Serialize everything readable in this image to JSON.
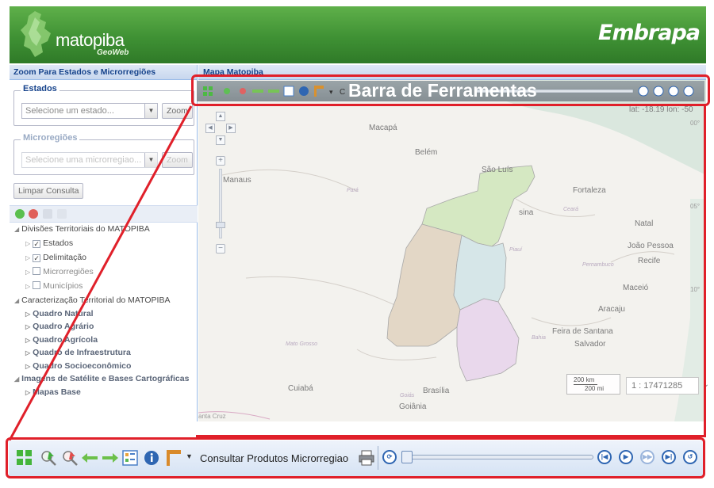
{
  "header": {
    "logo_text": "matopiba",
    "logo_sub": "GeoWeb",
    "brand": "Embrapa"
  },
  "left_panel": {
    "title": "Zoom Para Estados e Microrregiões",
    "estados": {
      "legend": "Estados",
      "placeholder": "Selecione um estado...",
      "zoom_label": "Zoom"
    },
    "microrregioes": {
      "legend": "Microregiões",
      "placeholder": "Selecione uma microrregiao...",
      "zoom_label": "Zoom"
    },
    "clear_label": "Limpar Consulta",
    "tree": {
      "divisoes": "Divisões Territoriais do MATOPIBA",
      "estados": "Estados",
      "delimitacao": "Delimitação",
      "microrregioes": "Microrregiões",
      "municipios": "Municípios",
      "caracterizacao": "Caracterização Territorial do MATOPIBA",
      "quadro_natural": "Quadro Natural",
      "quadro_agrario": "Quadro Agrário",
      "quadro_agricola": "Quadro Agrícola",
      "quadro_infra": "Quadro de Infraestrutura",
      "quadro_socio": "Quadro Socioeconômico",
      "imagens": "Imagens de Satélite e Bases Cartográficas",
      "mapas_base": "Mapas Base"
    }
  },
  "map": {
    "title": "Mapa Matopiba",
    "overlay_label": "Barra de Ferramentas",
    "coords": "lat: -18.19 lon: -50",
    "scale_text": "1 : 17471285",
    "scalebar_km": "200 km",
    "scalebar_mi": "200 mi",
    "places": {
      "macapa": "Macapá",
      "belem": "Belém",
      "sao_luis": "São Luís",
      "fortaleza": "Fortaleza",
      "manaus": "Manaus",
      "natal": "Natal",
      "joao_pessoa": "João Pessoa",
      "recife": "Recife",
      "maceio": "Maceió",
      "aracaju": "Aracaju",
      "feira": "Feira de Santana",
      "salvador": "Salvador",
      "cuiaba": "Cuiabá",
      "brasilia": "Brasília",
      "goiania": "Goiânia",
      "para": "Pará",
      "piaui": "Piauí",
      "ceara": "Ceará",
      "pernambuco": "Pernambuco",
      "bahia": "Bahia",
      "mato_grosso": "Mato Grosso",
      "goias": "Goiás",
      "santa_cruz": "anta Cruz",
      "sina": "sina",
      "lat_00": "00°",
      "lat_05": "05°",
      "lat_10": "10°"
    }
  },
  "bottom_toolbar": {
    "consult_label": "Consultar Produtos Microrregiao"
  }
}
